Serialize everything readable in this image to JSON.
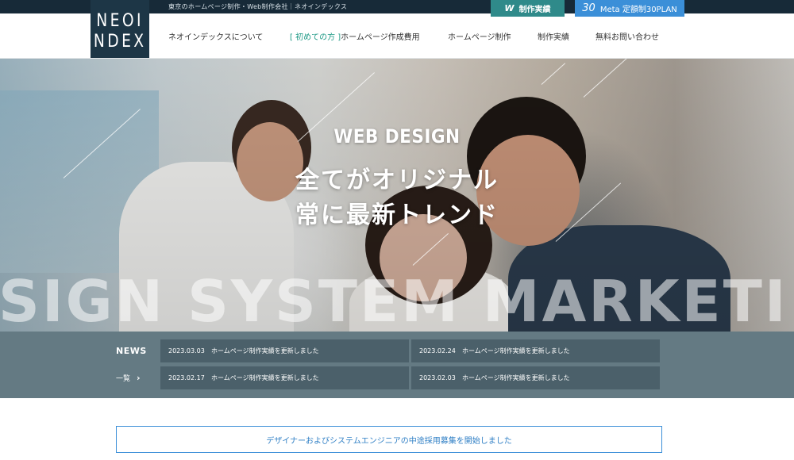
{
  "topbar": {
    "tagline": "東京のホームページ制作・Web制作会社｜ネオインデックス"
  },
  "logo": {
    "line1": "NEOI",
    "line2": "NDEX"
  },
  "top_buttons": {
    "works": {
      "icon": "W",
      "label": "制作実績"
    },
    "meta": {
      "number": "30",
      "label": "Meta 定額制30PLAN"
    }
  },
  "nav": {
    "about": "ネオインデックスについて",
    "first_time_accent": "[ 初めての方 ]",
    "first_time_rest": "ホームページ作成費用",
    "web_production": "ホームページ制作",
    "works": "制作実績",
    "contact": "無料お問い合わせ"
  },
  "hero": {
    "sub": "WEB DESIGN",
    "line1": "全てがオリジナル",
    "line2": "常に最新トレンド",
    "marquee": "SIGN  SYSTEM  MARKETI"
  },
  "news": {
    "label": "NEWS",
    "all": "一覧",
    "items": [
      {
        "date": "2023.03.03",
        "title": "ホームページ制作実績を更新しました"
      },
      {
        "date": "2023.02.24",
        "title": "ホームページ制作実績を更新しました"
      },
      {
        "date": "2023.02.17",
        "title": "ホームページ制作実績を更新しました"
      },
      {
        "date": "2023.02.03",
        "title": "ホームページ制作実績を更新しました"
      }
    ]
  },
  "recruit": {
    "text": "デザイナーおよびシステムエンジニアの中途採用募集を開始しました"
  }
}
